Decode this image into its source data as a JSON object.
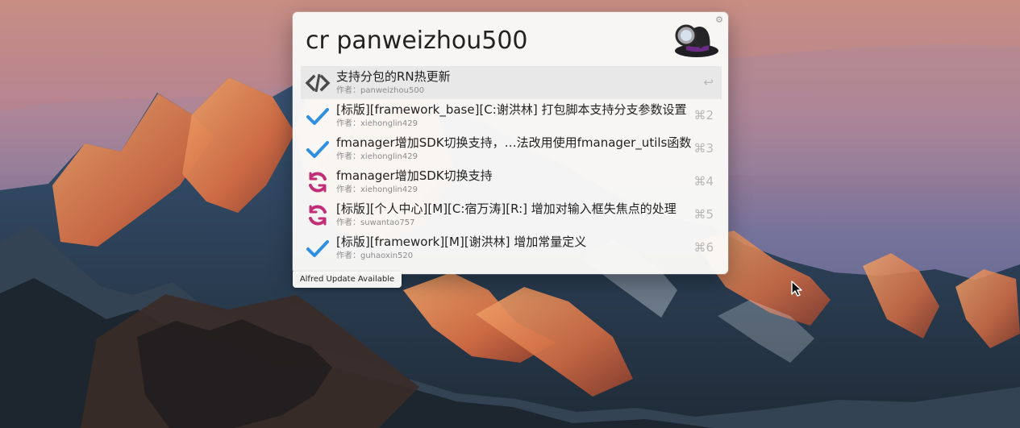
{
  "search": {
    "query": "cr panweizhou500"
  },
  "icons": {
    "settings": "gear-icon",
    "launcher": "alfred-hat-icon",
    "code": "code-icon",
    "check": "checkmark-icon",
    "sync": "refresh-icon",
    "enter": "return-icon",
    "command": "command-key-icon"
  },
  "results": [
    {
      "icon": "code-icon",
      "title": "支持分包的RN热更新",
      "subtitle": "作者：panweizhou500",
      "shortcut": "↩",
      "selected": true
    },
    {
      "icon": "checkmark-icon",
      "title": "[标版][framework_base][C:谢洪林] 打包脚本支持分支参数设置",
      "subtitle": "作者：xiehonglin429",
      "shortcut": "⌘2"
    },
    {
      "icon": "checkmark-icon",
      "title": "fmanager增加SDK切换支持，…法改用使用fmanager_utils函数",
      "subtitle": "作者：xiehonglin429",
      "shortcut": "⌘3"
    },
    {
      "icon": "refresh-icon",
      "title": "fmanager增加SDK切换支持",
      "subtitle": "作者：xiehonglin429",
      "shortcut": "⌘4"
    },
    {
      "icon": "refresh-icon",
      "title": "[标版][个人中心][M][C:宿万涛][R:] 增加对输入框失焦点的处理",
      "subtitle": "作者：suwantao757",
      "shortcut": "⌘5"
    },
    {
      "icon": "checkmark-icon",
      "title": "[标版][framework][M][谢洪林] 增加常量定义",
      "subtitle": "作者：guhaoxin520",
      "shortcut": "⌘6"
    }
  ],
  "footer": {
    "update_label": "Alfred Update Available"
  },
  "colors": {
    "selected_row": "#e8e8e8",
    "check": "#2f8fe0",
    "sync": "#c12f78",
    "code": "#4a4a4a"
  }
}
